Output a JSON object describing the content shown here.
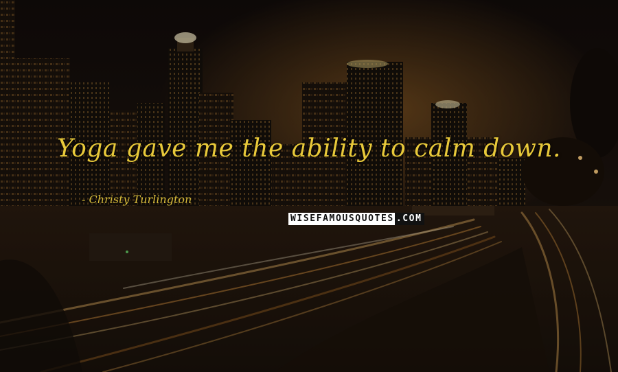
{
  "quote": {
    "text": "Yoga gave me the ability to calm down."
  },
  "author": {
    "text": "- Christy Turlington"
  },
  "watermark": {
    "part1": "WISEFAMOUSQUOTES",
    "part2": ".COM"
  },
  "colors": {
    "quote_text": "#e8c93a",
    "author_text": "#d9bd3c",
    "sky": "#160f0c",
    "city_glow": "#a86a26"
  }
}
